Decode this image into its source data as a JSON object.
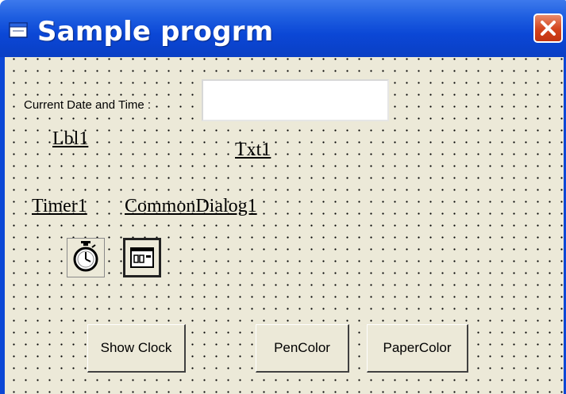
{
  "window": {
    "title": "Sample progrm",
    "close_icon": "close-icon",
    "app_icon": "form-icon"
  },
  "form": {
    "label_caption": "Current Date and  Time :",
    "textbox_value": "",
    "label_name": "Lbl1",
    "textbox_name": "Txt1",
    "timer_name": "Timer1",
    "dialog_name": "CommonDialog1"
  },
  "buttons": {
    "show_clock": "Show Clock",
    "pen_color": "PenColor",
    "paper_color": "PaperColor"
  },
  "colors": {
    "title_bar": "#0b47d6",
    "form_bg": "#ece9d8",
    "close_button": "#d3431c"
  }
}
